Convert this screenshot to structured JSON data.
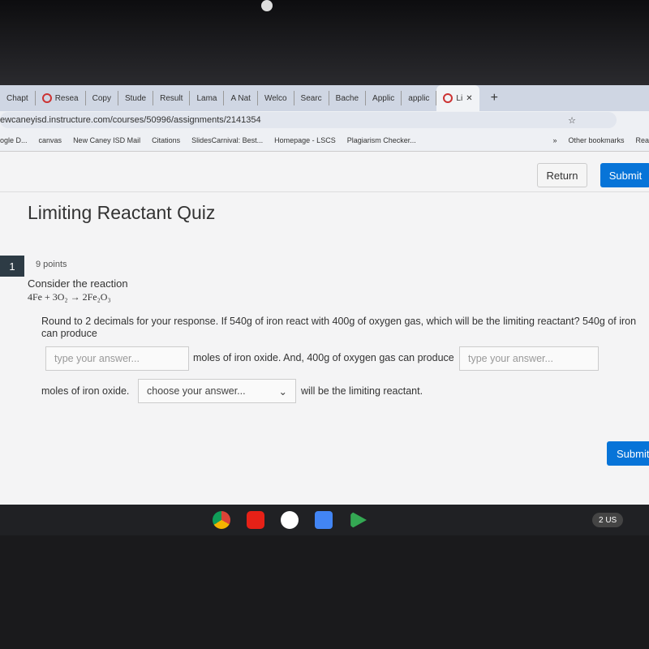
{
  "browser": {
    "tabs": [
      "Chapt",
      "Resea",
      "Copy",
      "Stude",
      "Result",
      "Lama",
      "A Nat",
      "Welco",
      "Searc",
      "Bache",
      "Applic",
      "applic",
      "Li"
    ],
    "new_tab": "+",
    "url": "ewcaneyisd.instructure.com/courses/50996/assignments/2141354",
    "bookmarks": [
      "ogle D...",
      "canvas",
      "New Caney ISD Mail",
      "Citations",
      "SlidesCarnival: Best...",
      "Homepage - LSCS",
      "Plagiarism Checker..."
    ],
    "more": "»",
    "other_bookmarks": "Other bookmarks",
    "reading": "Rea"
  },
  "header": {
    "return": "Return",
    "submit": "Submit"
  },
  "quiz": {
    "title": "Limiting Reactant Quiz",
    "number": "1",
    "points": "9 points",
    "intro": "Consider the reaction",
    "equation": "4Fe + 3O₂ → 2Fe₂O₃",
    "prompt": "Round to 2 decimals for your response. If 540g of iron react with 400g of oxygen gas, which will be the limiting reactant? 540g of iron can produce",
    "input1_placeholder": "type your answer...",
    "mid_text": "moles of iron oxide. And, 400g of oxygen gas can produce",
    "input2_placeholder": "type your answer...",
    "text3": "moles of iron oxide.",
    "select_placeholder": "choose your answer...",
    "text4": "will be the limiting reactant.",
    "submit": "Submit"
  },
  "shelf": {
    "status": "2 US"
  }
}
